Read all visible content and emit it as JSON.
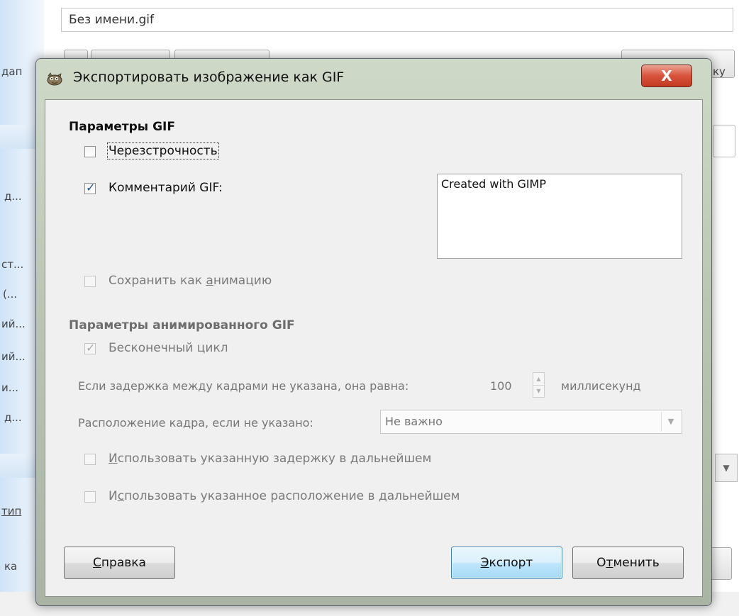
{
  "background": {
    "file_name": "Без имени.gif",
    "fragments": [
      "дап",
      "ку",
      "д...",
      "ст...",
      "(...",
      "ий...",
      "ий...",
      "и...",
      "д...",
      "тип",
      "ка"
    ]
  },
  "dialog": {
    "title": "Экспортировать изображение как GIF",
    "close_label": "X",
    "gif_params": {
      "title": "Параметры GIF",
      "interlace_label": "Черезстрочность",
      "interlace_checked": false,
      "comment_label": "Комментарий GIF:",
      "comment_checked": true,
      "comment_value": "Created with GIMP",
      "save_animation_label_pre": "Сохранить как ",
      "save_animation_label_u": "а",
      "save_animation_label_post": "нимацию",
      "save_animation_checked": false
    },
    "anim_params": {
      "title": "Параметры анимированного GIF",
      "loop_label": "Бесконечный цикл",
      "loop_checked": true,
      "delay_label": "Если задержка между кадрами не указана, она равна:",
      "delay_value": "100",
      "delay_unit": "миллисекунд",
      "disposal_label": "Расположение кадра, если не указано:",
      "disposal_value": "Не важно",
      "use_delay_u": "И",
      "use_delay_rest": "спользовать указанную задержку в дальнейшем",
      "use_disposal_pre": "И",
      "use_disposal_u": "с",
      "use_disposal_rest": "пользовать указанное расположение в дальнейшем"
    },
    "buttons": {
      "help_u": "С",
      "help_rest": "правка",
      "export_u": "Э",
      "export_rest": "кспорт",
      "cancel_pre": "О",
      "cancel_u": "т",
      "cancel_rest": "менить"
    }
  }
}
